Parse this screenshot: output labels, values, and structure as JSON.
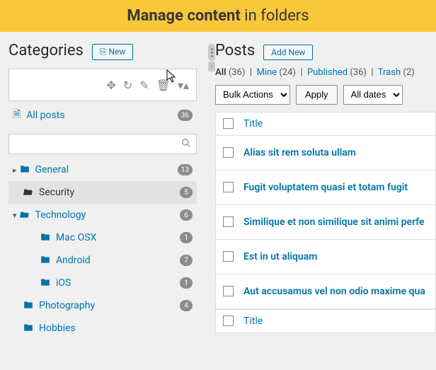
{
  "banner": {
    "strong": "Manage content",
    "rest": " in folders"
  },
  "left": {
    "heading": "Categories",
    "newBtn": "New",
    "allPosts": {
      "label": "All posts",
      "count": "36"
    },
    "folders": [
      {
        "label": "General",
        "count": "13",
        "expanded": false,
        "children": []
      },
      {
        "label": "Security",
        "count": "5",
        "active": true,
        "children": []
      },
      {
        "label": "Technology",
        "count": "6",
        "expanded": true,
        "children": [
          {
            "label": "Mac OSX",
            "count": "1"
          },
          {
            "label": "Android",
            "count": "7"
          },
          {
            "label": "iOS",
            "count": "1"
          }
        ]
      },
      {
        "label": "Photography",
        "count": "4",
        "children": []
      },
      {
        "label": "Hobbies",
        "count": "",
        "children": []
      }
    ]
  },
  "right": {
    "heading": "Posts",
    "addNew": "Add New",
    "filters": [
      {
        "label": "All",
        "count": "36",
        "active": true
      },
      {
        "label": "Mine",
        "count": "24"
      },
      {
        "label": "Published",
        "count": "36"
      },
      {
        "label": "Trash",
        "count": "2"
      }
    ],
    "bulkLabel": "Bulk Actions",
    "applyLabel": "Apply",
    "datesLabel": "All dates",
    "titleHeader": "Title",
    "posts": [
      "Alias sit rem soluta ullam",
      "Fugit voluptatem quasi et totam fugit",
      "Similique et non similique sit animi perfe",
      "Est in ut aliquam",
      "Aut accusamus vel non odio maxime qua"
    ]
  }
}
